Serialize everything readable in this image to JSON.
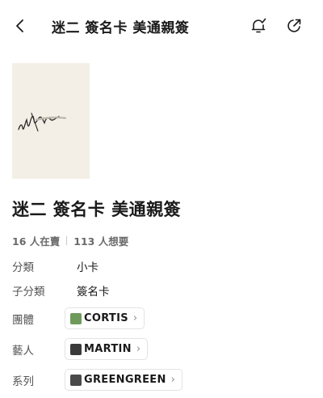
{
  "header": {
    "title": "迷二 簽名卡 美通親簽",
    "back_icon": "chevron-left-icon",
    "notify_icon": "bell-check-icon",
    "share_icon": "share-external-icon"
  },
  "product": {
    "image_alt_icon": "signed-card-image",
    "title": "迷二 簽名卡 美通親簽",
    "sellers_count": "16 人在賣",
    "wanters_count": "113 人想要"
  },
  "details": {
    "category_label": "分類",
    "category_value": "小卡",
    "subcategory_label": "子分類",
    "subcategory_value": "簽名卡",
    "group_label": "團體",
    "group_value": "CORTIS",
    "artist_label": "藝人",
    "artist_value": "MARTIN",
    "series_label": "系列",
    "series_value": "GREENGREEN",
    "chevron": "›"
  },
  "colors": {
    "text_primary": "#1a1a1a",
    "text_secondary": "#6b6b6b",
    "chip_border": "#e3e3e3",
    "group_thumb": "#6f9a5c",
    "artist_thumb": "#3a3a3a",
    "series_thumb": "#4a4a4a"
  }
}
